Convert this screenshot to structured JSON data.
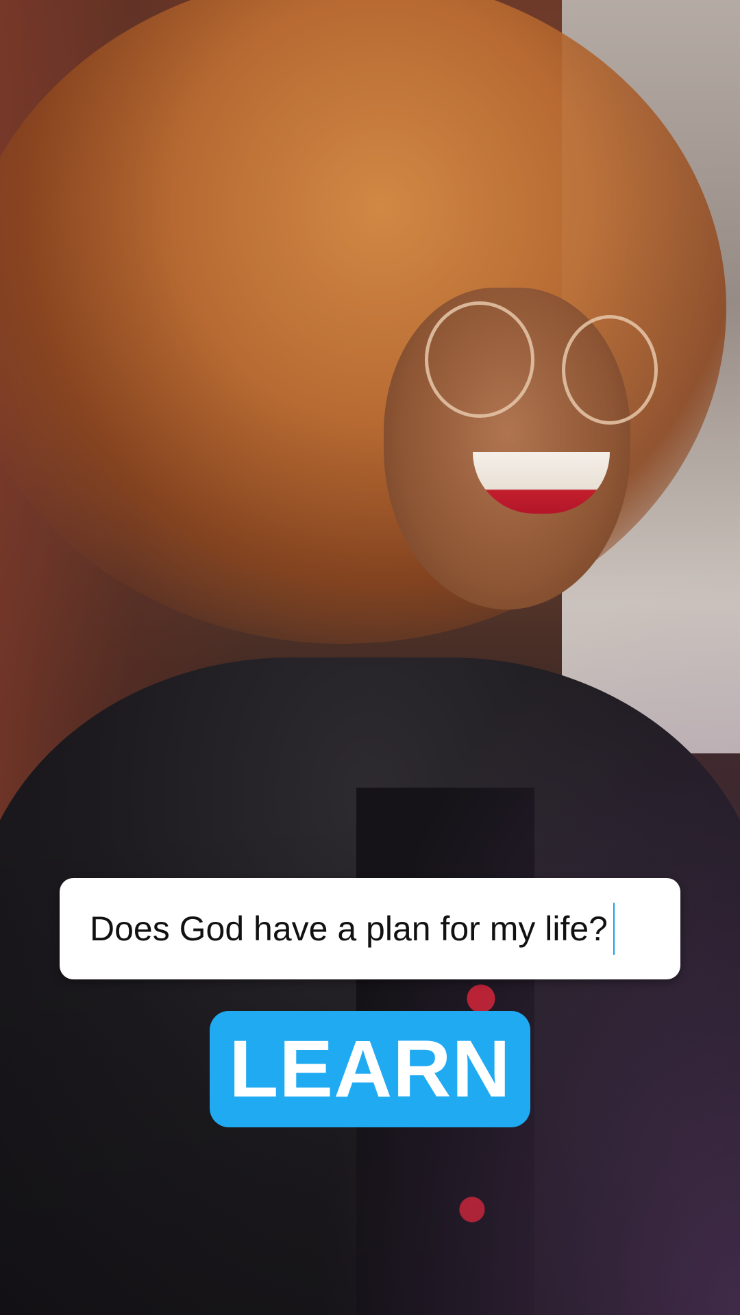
{
  "background": {
    "icon": "photo-smiling-woman",
    "accent": "#c8202e"
  },
  "question": {
    "text": "Does God have a plan for my life?"
  },
  "cta": {
    "label": "LEARN",
    "color": "#1faaf2"
  }
}
